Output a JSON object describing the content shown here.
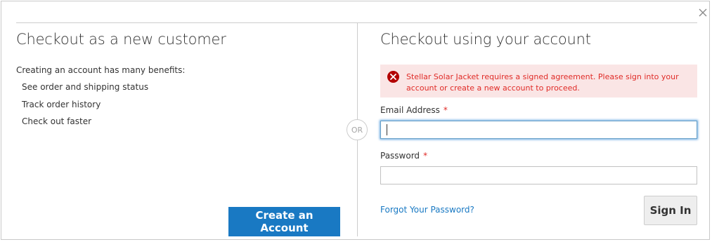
{
  "modal": {
    "close_icon": "close-icon",
    "or_label": "OR"
  },
  "new_customer": {
    "title": "Checkout as a new customer",
    "intro": "Creating an account has many benefits:",
    "benefits": [
      "See order and shipping status",
      "Track order history",
      "Check out faster"
    ],
    "create_button": "Create an Account"
  },
  "login": {
    "title": "Checkout using your account",
    "error_icon": "error-circle-x-icon",
    "error_message": "Stellar Solar Jacket requires a signed agreement. Please sign into your account or create a new account to proceed.",
    "email_label": "Email Address",
    "email_value": "",
    "password_label": "Password",
    "password_value": "",
    "required_mark": "*",
    "forgot_link": "Forgot Your Password?",
    "signin_button": "Sign In"
  },
  "colors": {
    "primary": "#1979c3",
    "error_bg": "#fae5e5",
    "error_text": "#e02b27",
    "error_icon": "#b30000"
  }
}
